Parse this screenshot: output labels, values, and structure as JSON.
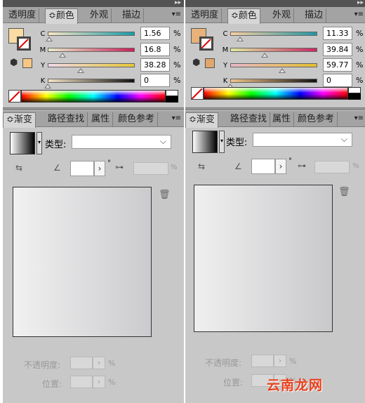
{
  "panels": [
    {
      "tabs": [
        "透明度",
        "≎颜色",
        "外观",
        "描边"
      ],
      "channels": [
        {
          "label": "C",
          "value": "1.56",
          "unit": "%",
          "level": 0.0156,
          "gradient": "#f7e7c4,#1b9ba8"
        },
        {
          "label": "M",
          "value": "16.8",
          "unit": "%",
          "level": 0.168,
          "gradient": "#e8edc9,#c5215a"
        },
        {
          "label": "Y",
          "value": "38.28",
          "unit": "%",
          "level": 0.3828,
          "gradient": "#f1d9e9,#e8c836"
        },
        {
          "label": "K",
          "value": "0",
          "unit": "%",
          "level": 0.0,
          "gradient": "#f4e3c4,#111111"
        }
      ],
      "fill_color": "#f9dba4",
      "gamut_color": "#f6c784",
      "gradient_panel": {
        "tabs": [
          "≎渐变",
          "路径查找",
          "属性",
          "颜色参考"
        ],
        "type_label": "类型:",
        "opacity_label": "不透明度:",
        "location_label": "位置:",
        "pct": "%",
        "degree": "°",
        "preview_start": "#f1f1f2",
        "preview_end": "#cbcacc"
      }
    },
    {
      "tabs": [
        "透明度",
        "≎颜色",
        "外观",
        "描边"
      ],
      "channels": [
        {
          "label": "C",
          "value": "11.33",
          "unit": "%",
          "level": 0.1133,
          "gradient": "#f9cfa0,#2197a4"
        },
        {
          "label": "M",
          "value": "39.84",
          "unit": "%",
          "level": 0.3984,
          "gradient": "#dfeaa0,#c62862"
        },
        {
          "label": "Y",
          "value": "59.77",
          "unit": "%",
          "level": 0.5977,
          "gradient": "#e6b8c8,#e5bf2e"
        },
        {
          "label": "K",
          "value": "0",
          "unit": "%",
          "level": 0.0,
          "gradient": "#f2c48a,#111111"
        }
      ],
      "fill_color": "#e8b27a",
      "gamut_color": "#e0a66c",
      "gradient_panel": {
        "tabs": [
          "≎渐变",
          "路径查找",
          "属性",
          "颜色参考"
        ],
        "type_label": "类型:",
        "opacity_label": "不透明度:",
        "location_label": "位置:",
        "pct": "%",
        "degree": "°",
        "preview_start": "#efeff0",
        "preview_end": "#c9c8ca"
      }
    }
  ],
  "watermark": "云南龙网"
}
